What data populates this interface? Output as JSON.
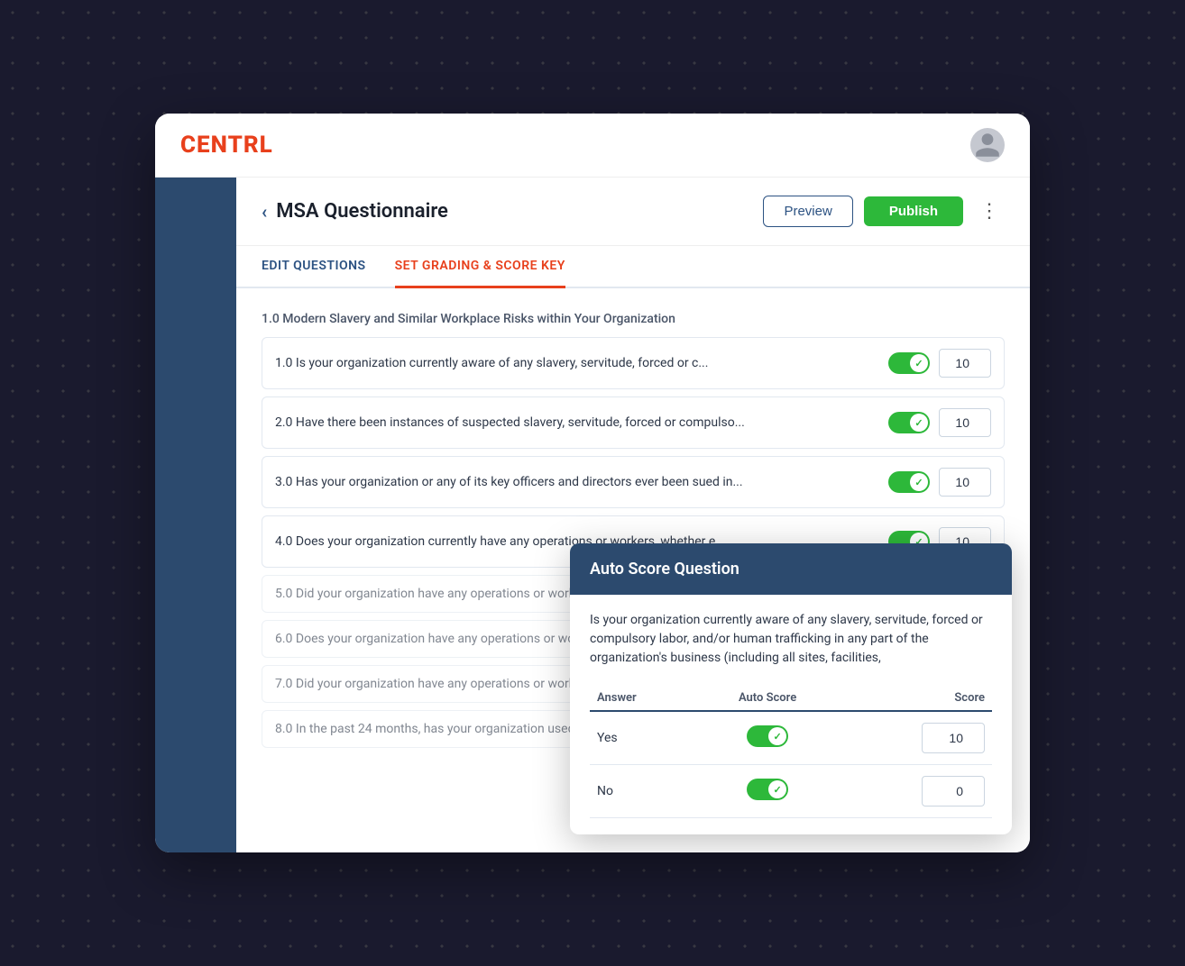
{
  "dots": true,
  "header": {
    "logo": "CENTRL"
  },
  "page": {
    "back_label": "‹",
    "title": "MSA Questionnaire",
    "preview_btn": "Preview",
    "publish_btn": "Publish",
    "more_icon": "⋮"
  },
  "tabs": [
    {
      "label": "EDIT QUESTIONS",
      "active": false
    },
    {
      "label": "SET GRADING & SCORE KEY",
      "active": true
    }
  ],
  "section_header": "1.0  Modern Slavery and Similar Workplace Risks within Your Organization",
  "questions": [
    {
      "id": "q1",
      "text": "1.0 Is your organization currently aware of any slavery, servitude, forced or c...",
      "score": 10,
      "toggle_on": true
    },
    {
      "id": "q2",
      "text": "2.0 Have there been instances of suspected slavery, servitude, forced or compulso...",
      "score": 10,
      "toggle_on": true
    },
    {
      "id": "q3",
      "text": "3.0 Has your organization or any of its key officers and directors ever been sued in...",
      "score": 10,
      "toggle_on": true
    },
    {
      "id": "q4",
      "text": "4.0 Does your organization currently have any operations or workers, whether e...",
      "score": 10,
      "toggle_on": true
    },
    {
      "id": "q5",
      "text": "5.0 Did your organization have any operations or workers, wheth...",
      "score": null,
      "toggle_on": false
    },
    {
      "id": "q6",
      "text": "6.0 Does your organization have any operations or workers, whe...",
      "score": null,
      "toggle_on": false
    },
    {
      "id": "q7",
      "text": "7.0 Did your organization have any operations or workers, wheth...",
      "score": null,
      "toggle_on": false
    },
    {
      "id": "q8",
      "text": "8.0 In the past 24 months, has your organization used migrant w...",
      "score": null,
      "toggle_on": false
    }
  ],
  "modal": {
    "title": "Auto Score Question",
    "question_text": "Is your organization currently aware of any slavery, servitude, forced or compulsory labor, and/or human trafficking in any part of the organization's business (including all sites, facilities,",
    "table_headers": {
      "answer": "Answer",
      "auto_score": "Auto Score",
      "score": "Score"
    },
    "answers": [
      {
        "label": "Yes",
        "toggle_on": true,
        "score": 10
      },
      {
        "label": "No",
        "toggle_on": true,
        "score": 0
      }
    ]
  }
}
